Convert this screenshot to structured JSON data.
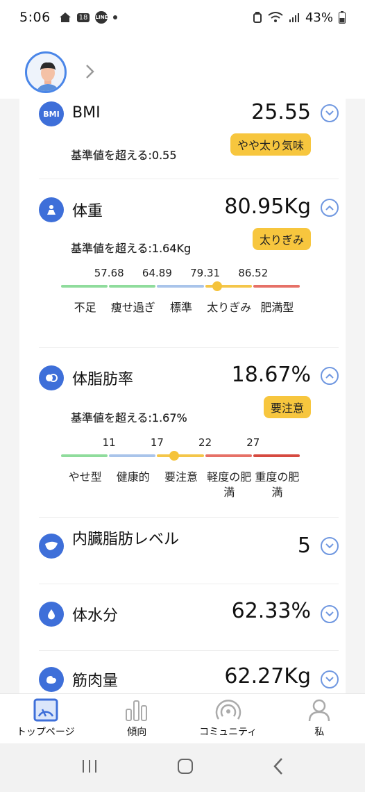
{
  "status_bar": {
    "time": "5:06",
    "calendar_badge": "18",
    "line_badge": "LINE",
    "battery": "43%"
  },
  "metrics": [
    {
      "name": "BMI",
      "icon_text": "BMI",
      "value": "25.55",
      "sub": "基準値を超える:0.55",
      "badge": "やや太り気味",
      "expanded": false
    },
    {
      "name": "体重",
      "value": "80.95Kg",
      "sub": "基準値を超える:1.64Kg",
      "badge": "太りぎみ",
      "expanded": true,
      "scale": {
        "ticks": [
          "57.68",
          "64.89",
          "79.31",
          "86.52"
        ],
        "labels": [
          "不足",
          "痩せ過ぎ",
          "標準",
          "太りぎみ",
          "肥満型"
        ],
        "colors": [
          "#8fdc9c",
          "#8fdc9c",
          "#a9c4ea",
          "#f4c64a",
          "#e67167"
        ],
        "marker_position": 0.65
      }
    },
    {
      "name": "体脂肪率",
      "value": "18.67%",
      "sub": "基準値を超える:1.67%",
      "badge": "要注意",
      "expanded": true,
      "scale": {
        "ticks": [
          "11",
          "17",
          "22",
          "27"
        ],
        "labels": [
          "やせ型",
          "健康的",
          "要注意",
          "軽度の肥満",
          "重度の肥満"
        ],
        "colors": [
          "#8fdc9c",
          "#a9c4ea",
          "#f4c64a",
          "#e67167",
          "#d64a40"
        ],
        "marker_position": 0.47
      }
    },
    {
      "name": "内臓脂肪レベル",
      "value": "5",
      "expanded": false
    },
    {
      "name": "体水分",
      "value": "62.33%",
      "expanded": false
    },
    {
      "name": "筋肉量",
      "value": "62.27Kg",
      "expanded": false
    }
  ],
  "bottom_nav": [
    {
      "label": "トップページ",
      "icon": "gauge-icon",
      "active": true
    },
    {
      "label": "傾向",
      "icon": "bar-chart-icon",
      "active": false
    },
    {
      "label": "コミュニティ",
      "icon": "broadcast-icon",
      "active": false
    },
    {
      "label": "私",
      "icon": "person-icon",
      "active": false
    }
  ],
  "colors": {
    "accent": "#3e6fd9",
    "badge": "#f7c63e"
  }
}
